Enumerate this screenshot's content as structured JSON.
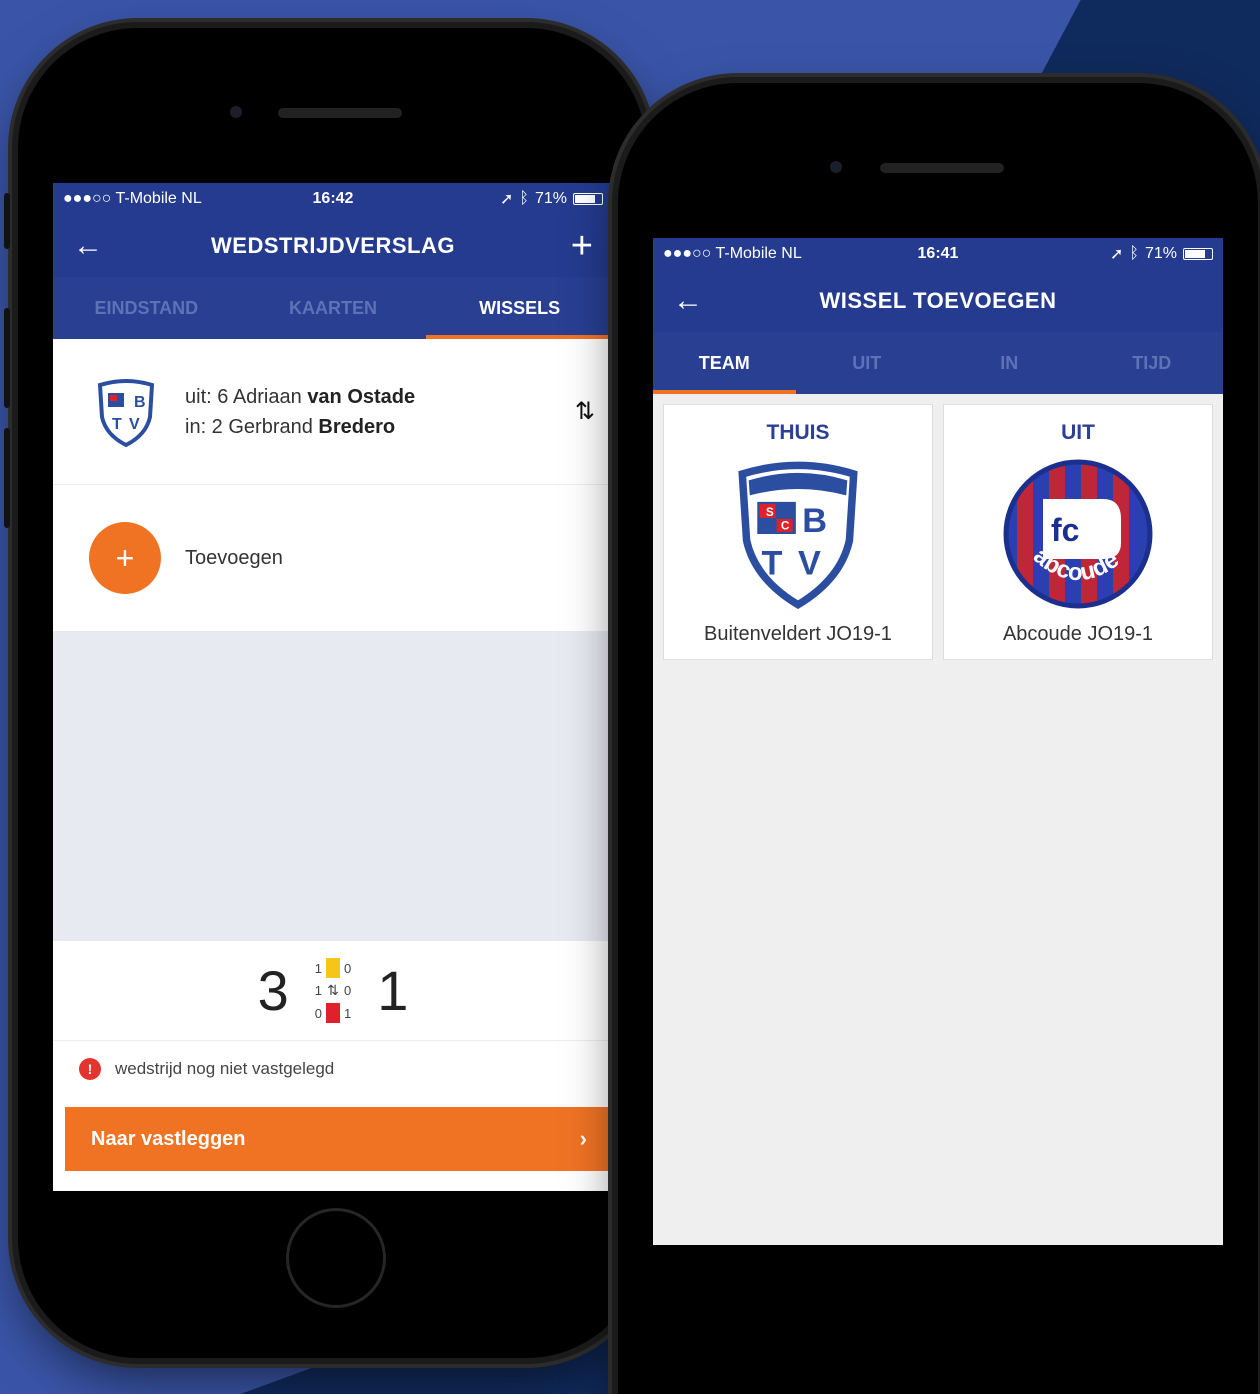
{
  "left_phone": {
    "status": {
      "carrier": "●●●○○ T-Mobile NL",
      "time": "16:42",
      "battery": "71%"
    },
    "appbar": {
      "title": "WEDSTRIJDVERSLAG",
      "back_icon": "arrow-left-icon",
      "add_icon": "plus-icon"
    },
    "tabs": [
      {
        "label": "EINDSTAND",
        "active": false
      },
      {
        "label": "KAARTEN",
        "active": false
      },
      {
        "label": "WISSELS",
        "active": true
      }
    ],
    "substitution": {
      "out_prefix": "uit: 6 Adriaan",
      "out_bold": "van Ostade",
      "in_prefix": "in: 2 Gerbrand",
      "in_bold": "Bredero"
    },
    "add_label": "Toevoegen",
    "score": {
      "home": "3",
      "away": "1",
      "yellow_home": "1",
      "yellow_away": "0",
      "subs_home": "1",
      "subs_away": "0",
      "red_home": "0",
      "red_away": "1"
    },
    "warning": "wedstrijd nog niet vastgelegd",
    "cta_label": "Naar vastleggen",
    "colors": {
      "primary": "#243b8f",
      "accent": "#f07324"
    }
  },
  "right_phone": {
    "status": {
      "carrier": "●●●○○ T-Mobile NL",
      "time": "16:41",
      "battery": "71%"
    },
    "appbar": {
      "title": "WISSEL TOEVOEGEN",
      "back_icon": "arrow-left-icon"
    },
    "tabs": [
      {
        "label": "TEAM",
        "active": true
      },
      {
        "label": "UIT",
        "active": false
      },
      {
        "label": "IN",
        "active": false
      },
      {
        "label": "TIJD",
        "active": false
      }
    ],
    "teams": [
      {
        "side": "THUIS",
        "name": "Buitenveldert JO19-1"
      },
      {
        "side": "UIT",
        "name": "Abcoude JO19-1",
        "logo_text": "fc",
        "logo_arc": "abcoude"
      }
    ]
  }
}
